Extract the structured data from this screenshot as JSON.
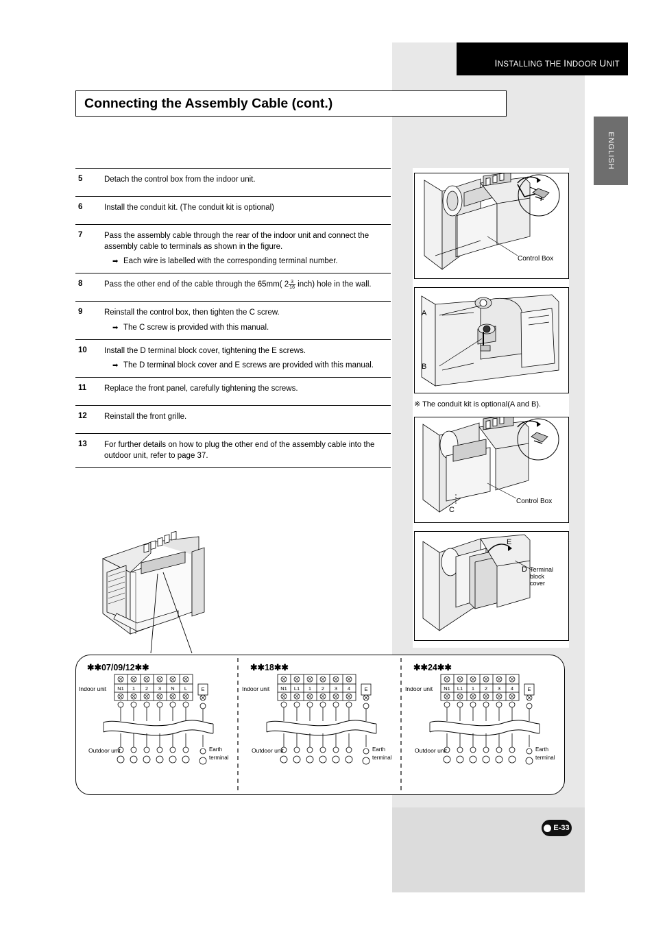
{
  "header": {
    "running_head": "Installing the Indoor Unit",
    "running_head_caps": "I",
    "language_tab": "ENGLISH"
  },
  "title": "Connecting the Assembly Cable (cont.)",
  "steps": [
    {
      "num": "5",
      "text": "Detach the control box from the indoor unit.",
      "sub": null
    },
    {
      "num": "6",
      "text": "Install the conduit kit. (The conduit kit is optional)",
      "sub": null
    },
    {
      "num": "7",
      "text": "Pass the assembly cable through the rear of the indoor unit and connect the assembly cable to terminals as shown in the figure.",
      "sub": "Each wire is labelled with the corresponding terminal number."
    },
    {
      "num": "8",
      "text": "Pass the other end of the cable through the 65mm( 2 3/16 inch) hole in the wall.",
      "sub": null
    },
    {
      "num": "9",
      "text": "Reinstall the control box, then tighten the C screw.",
      "sub": "The C screw is provided with this manual."
    },
    {
      "num": "10",
      "text": "Install the D terminal block cover, tightening the E screws.",
      "sub": "The D terminal block cover and E screws are provided with this manual."
    },
    {
      "num": "11",
      "text": "Replace the front panel, carefully tightening the screws.",
      "sub": null
    },
    {
      "num": "12",
      "text": "Reinstall the front grille.",
      "sub": null
    },
    {
      "num": "13",
      "text": "For further details on how to plug the other end of the assembly cable into the outdoor unit, refer to page 37.",
      "sub": null
    }
  ],
  "step8_parts": {
    "pre": "Pass the other end of the cable through the 65mm(",
    "num": "2",
    "frac_n": "3",
    "frac_d": "16",
    "post": "inch) hole in the wall."
  },
  "figures": {
    "fig1_label": "Control Box",
    "fig2_label_a": "A",
    "fig2_label_b": "B",
    "fig2_note": "※ The conduit kit is optional(A and B).",
    "fig3_label_c": "C",
    "fig3_label_box": "Control Box",
    "fig4_label_e": "E",
    "fig4_label_d": "D",
    "fig4_label_cover": "Terminal block cover"
  },
  "wiring": {
    "panels": [
      {
        "title": "✱✱07/09/12✱✱",
        "indoor_label": "Indoor unit",
        "outdoor_label": "Outdoor unit",
        "earth_label": "Earth terminal",
        "earth_mark": "E",
        "terminals": [
          "N1",
          "1",
          "2",
          "3",
          "N",
          "L"
        ]
      },
      {
        "title": "✱✱18✱✱",
        "indoor_label": "Indoor unit",
        "outdoor_label": "Outdoor unit",
        "earth_label": "Earth terminal",
        "earth_mark": "E",
        "terminals": [
          "N1",
          "L1",
          "1",
          "2",
          "3",
          "4"
        ]
      },
      {
        "title": "✱✱24✱✱",
        "indoor_label": "Indoor unit",
        "outdoor_label": "Outdoor unit",
        "earth_label": "Earth terminal",
        "earth_mark": "E",
        "terminals": [
          "N1",
          "L1",
          "1",
          "2",
          "3",
          "4"
        ]
      }
    ]
  },
  "page_number": "E-33"
}
